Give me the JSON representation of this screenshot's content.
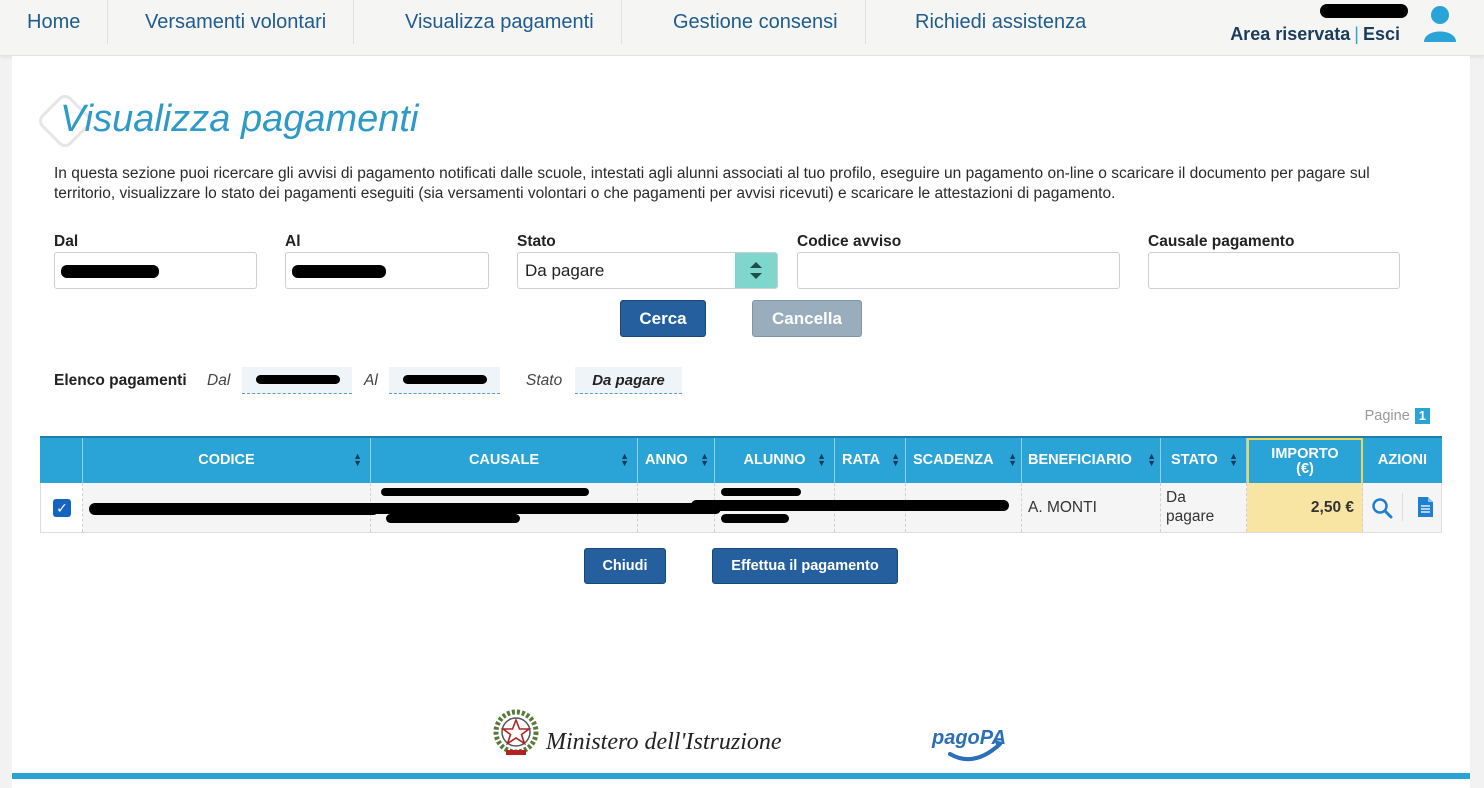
{
  "nav": {
    "items": [
      "Home",
      "Versamenti volontari",
      "Visualizza pagamenti",
      "Gestione consensi",
      "Richiedi assistenza"
    ],
    "area_riservata": "Area riservata",
    "separator": "|",
    "esci": "Esci"
  },
  "page": {
    "title": "Visualizza pagamenti",
    "intro": "In questa sezione puoi ricercare gli avvisi di pagamento notificati dalle scuole, intestati agli alunni associati al tuo profilo, eseguire un pagamento on-line o scaricare il documento per pagare sul territorio, visualizzare lo stato dei pagamenti eseguiti (sia versamenti volontari o che pagamenti per avvisi ricevuti) e scaricare le attestazioni di pagamento."
  },
  "filters": {
    "dal_label": "Dal",
    "al_label": "Al",
    "stato_label": "Stato",
    "stato_value": "Da pagare",
    "codice_label": "Codice avviso",
    "causale_label": "Causale pagamento",
    "cerca": "Cerca",
    "cancella": "Cancella"
  },
  "summary": {
    "label": "Elenco pagamenti",
    "dal": "Dal",
    "al": "Al",
    "stato": "Stato",
    "stato_value": "Da pagare"
  },
  "pagination": {
    "label": "Pagine",
    "current": "1"
  },
  "table": {
    "headers": [
      "CODICE",
      "CAUSALE",
      "ANNO",
      "ALUNNO",
      "RATA",
      "SCADENZA",
      "BENEFICIARIO",
      "STATO",
      "IMPORTO (€)",
      "AZIONI"
    ],
    "importo_line1": "IMPORTO",
    "importo_line2": "(€)",
    "row": {
      "beneficiario": "A. MONTI",
      "stato_line1": "Da",
      "stato_line2": "pagare",
      "importo": "2,50 €"
    }
  },
  "actions": {
    "chiudi": "Chiudi",
    "effettua": "Effettua il pagamento"
  },
  "footer": {
    "ministero": "Ministero dell'Istruzione",
    "pagopa": "pagoPA"
  },
  "colors": {
    "accent": "#2aa3d6",
    "nav_text": "#1f5b8c",
    "primary_button": "#255f9e",
    "importo_bg": "#f9e5a3"
  }
}
